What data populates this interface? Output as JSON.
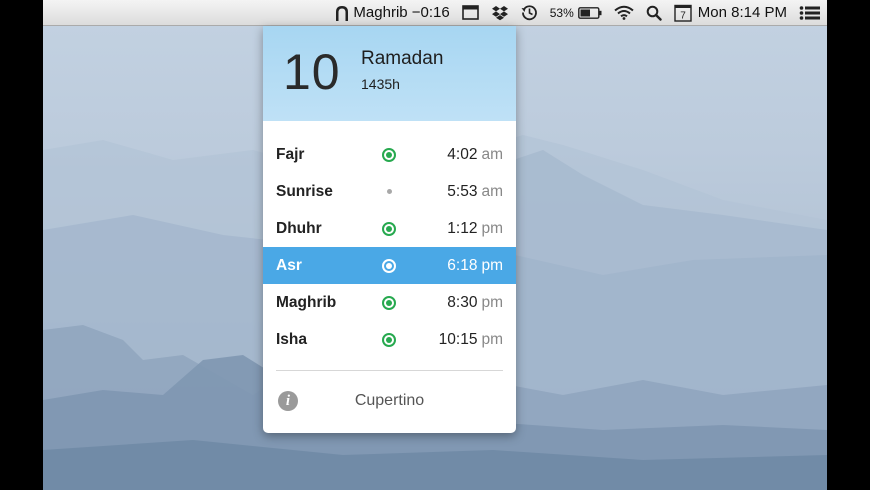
{
  "menubar": {
    "prayer_status": "Maghrib −0:16",
    "battery_percent": "53%",
    "calendar_day": "7",
    "clock": "Mon 8:14 PM",
    "icons": [
      "mosque-arch-icon",
      "window-icon",
      "dropbox-icon",
      "time-machine-icon",
      "battery-icon",
      "wifi-icon",
      "spotlight-icon",
      "calendar-icon",
      "notification-center-icon"
    ]
  },
  "popover": {
    "day": "10",
    "month": "Ramadan",
    "year": "1435h",
    "prayers": [
      {
        "name": "Fajr",
        "time": "4:02",
        "ampm": "am",
        "indicator": "ring"
      },
      {
        "name": "Sunrise",
        "time": "5:53",
        "ampm": "am",
        "indicator": "dot"
      },
      {
        "name": "Dhuhr",
        "time": "1:12",
        "ampm": "pm",
        "indicator": "ring"
      },
      {
        "name": "Asr",
        "time": "6:18",
        "ampm": "pm",
        "indicator": "ring",
        "active": true
      },
      {
        "name": "Maghrib",
        "time": "8:30",
        "ampm": "pm",
        "indicator": "ring"
      },
      {
        "name": "Isha",
        "time": "10:15",
        "ampm": "pm",
        "indicator": "ring"
      }
    ],
    "info_icon": "i",
    "location": "Cupertino"
  },
  "colors": {
    "accent": "#4aa8e6",
    "alarm_green": "#27a94f",
    "header_blue": "#bfe1f6"
  }
}
